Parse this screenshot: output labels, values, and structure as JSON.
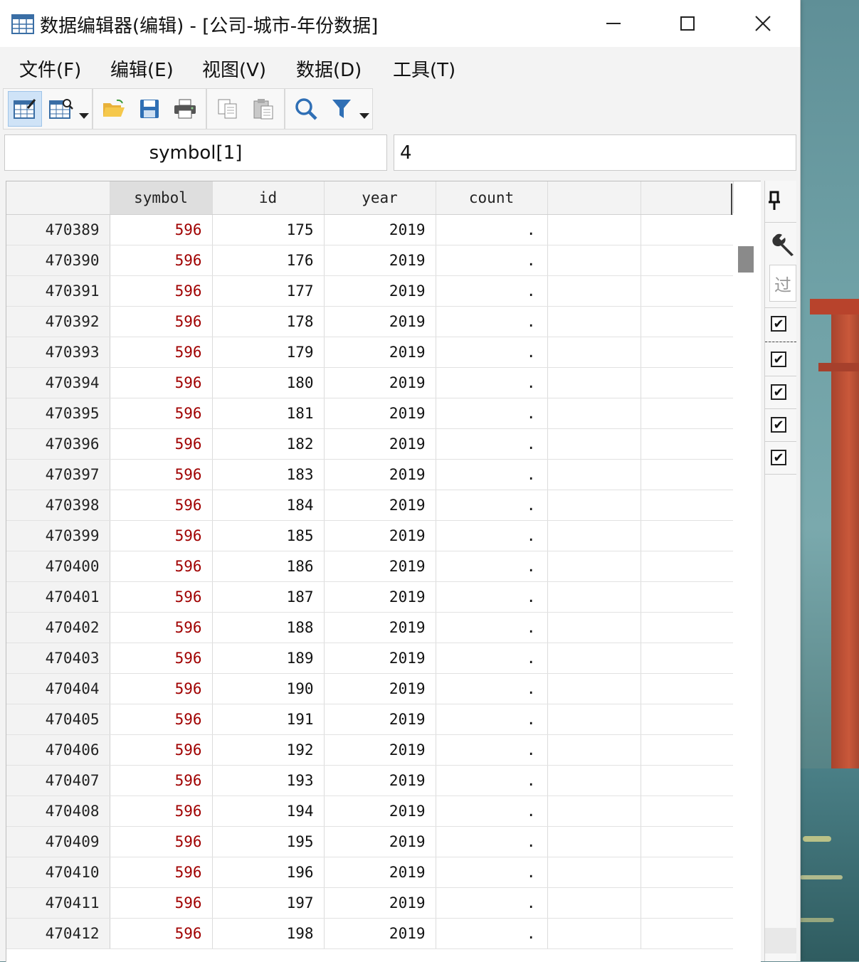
{
  "window": {
    "title": "数据编辑器(编辑) - [公司-城市-年份数据]",
    "minimize": "—",
    "maximize": "☐",
    "close": "✕"
  },
  "menu": [
    {
      "label": "文件(F)"
    },
    {
      "label": "编辑(E)"
    },
    {
      "label": "视图(V)"
    },
    {
      "label": "数据(D)"
    },
    {
      "label": "工具(T)"
    }
  ],
  "toolbar": {
    "icons": [
      "data-editor-edit-icon",
      "data-browser-icon",
      "open-folder-icon",
      "save-icon",
      "print-icon",
      "copy-icon",
      "paste-icon",
      "find-icon",
      "filter-icon"
    ]
  },
  "cell_ref": {
    "variable": "symbol[1]",
    "value": "4"
  },
  "grid": {
    "columns": [
      "symbol",
      "id",
      "year",
      "count"
    ],
    "rows": [
      {
        "n": "470389",
        "symbol": "596",
        "id": "175",
        "year": "2019",
        "count": "."
      },
      {
        "n": "470390",
        "symbol": "596",
        "id": "176",
        "year": "2019",
        "count": "."
      },
      {
        "n": "470391",
        "symbol": "596",
        "id": "177",
        "year": "2019",
        "count": "."
      },
      {
        "n": "470392",
        "symbol": "596",
        "id": "178",
        "year": "2019",
        "count": "."
      },
      {
        "n": "470393",
        "symbol": "596",
        "id": "179",
        "year": "2019",
        "count": "."
      },
      {
        "n": "470394",
        "symbol": "596",
        "id": "180",
        "year": "2019",
        "count": "."
      },
      {
        "n": "470395",
        "symbol": "596",
        "id": "181",
        "year": "2019",
        "count": "."
      },
      {
        "n": "470396",
        "symbol": "596",
        "id": "182",
        "year": "2019",
        "count": "."
      },
      {
        "n": "470397",
        "symbol": "596",
        "id": "183",
        "year": "2019",
        "count": "."
      },
      {
        "n": "470398",
        "symbol": "596",
        "id": "184",
        "year": "2019",
        "count": "."
      },
      {
        "n": "470399",
        "symbol": "596",
        "id": "185",
        "year": "2019",
        "count": "."
      },
      {
        "n": "470400",
        "symbol": "596",
        "id": "186",
        "year": "2019",
        "count": "."
      },
      {
        "n": "470401",
        "symbol": "596",
        "id": "187",
        "year": "2019",
        "count": "."
      },
      {
        "n": "470402",
        "symbol": "596",
        "id": "188",
        "year": "2019",
        "count": "."
      },
      {
        "n": "470403",
        "symbol": "596",
        "id": "189",
        "year": "2019",
        "count": "."
      },
      {
        "n": "470404",
        "symbol": "596",
        "id": "190",
        "year": "2019",
        "count": "."
      },
      {
        "n": "470405",
        "symbol": "596",
        "id": "191",
        "year": "2019",
        "count": "."
      },
      {
        "n": "470406",
        "symbol": "596",
        "id": "192",
        "year": "2019",
        "count": "."
      },
      {
        "n": "470407",
        "symbol": "596",
        "id": "193",
        "year": "2019",
        "count": "."
      },
      {
        "n": "470408",
        "symbol": "596",
        "id": "194",
        "year": "2019",
        "count": "."
      },
      {
        "n": "470409",
        "symbol": "596",
        "id": "195",
        "year": "2019",
        "count": "."
      },
      {
        "n": "470410",
        "symbol": "596",
        "id": "196",
        "year": "2019",
        "count": "."
      },
      {
        "n": "470411",
        "symbol": "596",
        "id": "197",
        "year": "2019",
        "count": "."
      },
      {
        "n": "470412",
        "symbol": "596",
        "id": "198",
        "year": "2019",
        "count": "."
      }
    ]
  },
  "side_panel": {
    "pin_icon": "pin-icon",
    "tools_icon": "wrench-icon",
    "filter_placeholder": "过滤",
    "checkboxes": [
      "✔",
      "✔",
      "✔",
      "✔",
      "✔"
    ]
  },
  "colors": {
    "string_value": "#a00000",
    "active_tool": "#cfe3f7"
  }
}
